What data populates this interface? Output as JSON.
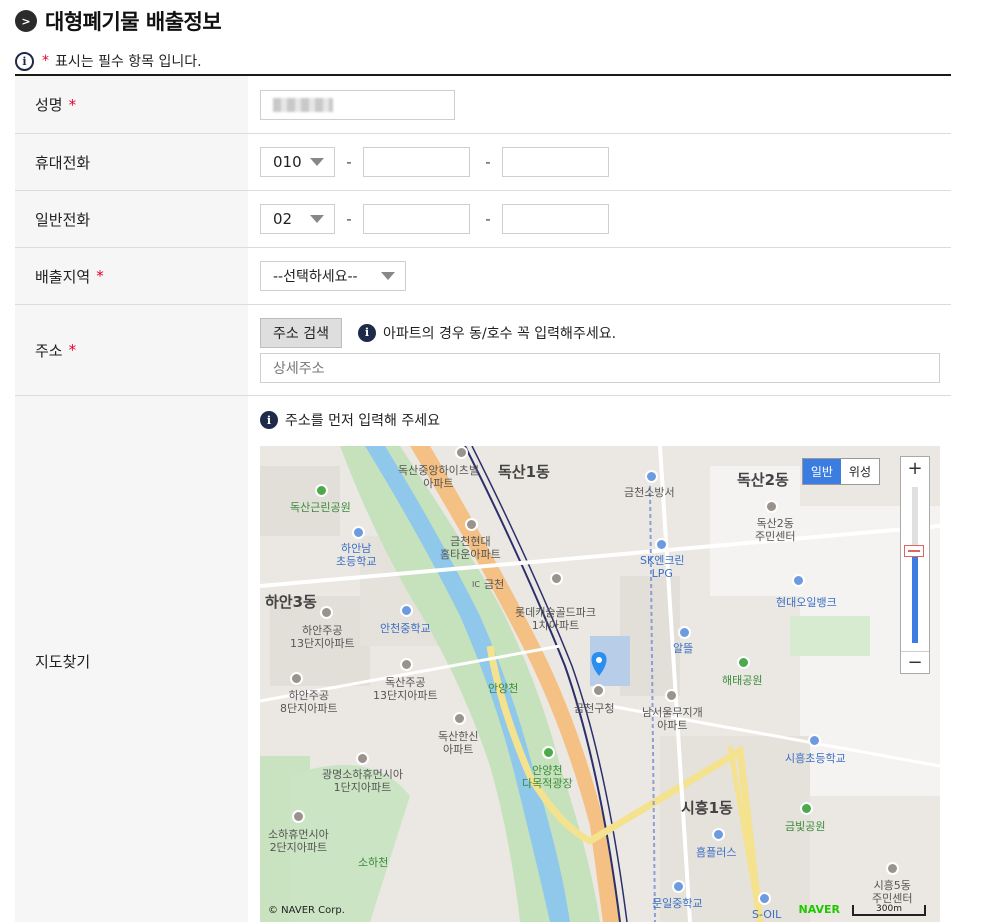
{
  "header": {
    "bullet": ">",
    "title": "대형폐기물 배출정보"
  },
  "notice": {
    "icon": "i",
    "star": "*",
    "text": "표시는 필수 항목 입니다."
  },
  "form": {
    "name": {
      "label": "성명",
      "star": "*"
    },
    "mobile": {
      "label": "휴대전화",
      "prefix": "010",
      "dash": "-"
    },
    "phone": {
      "label": "일반전화",
      "prefix": "02",
      "dash": "-"
    },
    "region": {
      "label": "배출지역",
      "star": "*",
      "selected": "--선택하세요--"
    },
    "address": {
      "label": "주소",
      "star": "*",
      "search_button": "주소 검색",
      "hint": "아파트의 경우 동/호수 꼭 입력해주세요.",
      "detail_placeholder": "상세주소"
    },
    "map": {
      "label": "지도찾기",
      "hint": "주소를 먼저 입력해 주세요"
    }
  },
  "map_view": {
    "type_normal": "일반",
    "type_satellite": "위성",
    "zoom_in": "+",
    "zoom_out": "−",
    "zoom_level": 0.59,
    "copyright": "© NAVER Corp.",
    "brand": "NAVER",
    "scale": "300m",
    "labels": {
      "a": "독산중앙하이츠빌\n아파트",
      "b": "독산1동",
      "c": "금천소방서",
      "d": "독산2동",
      "e": "독산근린공원",
      "f": "금천현대\n홈타운아파트",
      "g": "독산2동\n주민센터",
      "h": "하안남\n초등학교",
      "i": "SK엔크린\nLPG",
      "j": "하안3동",
      "k": "롯데캐슬골드파크\n1차아파트",
      "l": "현대오일뱅크",
      "m": "하안주공\n13단지아파트",
      "n": "안천중학교",
      "o": "알뜰",
      "p": "독산주공\n13단지아파트",
      "q": "해태공원",
      "r": "안양천",
      "s": "금천구청",
      "t": "하안주공\n8단지아파트",
      "u": "남서울무지개\n아파트",
      "v": "독산한신\n아파트",
      "w": "시흥초등학교",
      "x": "광명소하휴먼시아\n1단지아파트",
      "y": "안양천\n다목적광장",
      "z": "시흥1동",
      "aa": "금빛공원",
      "ab": "소하휴먼시아\n2단지아파트",
      "ac": "흠플러스",
      "ad": "소하천",
      "ae": "문일중학교",
      "af": "S-OIL",
      "ag": "시흥5동\n주민센터",
      "ah": "금천",
      "ai": "IC"
    }
  }
}
